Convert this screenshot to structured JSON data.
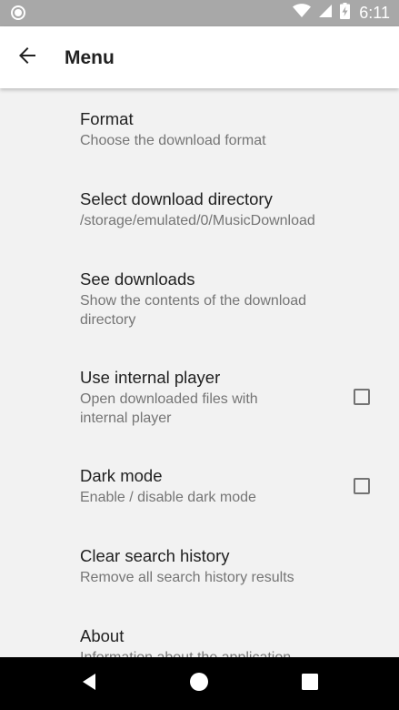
{
  "status_bar": {
    "time": "6:11",
    "left_icon": "circle-notification-icon",
    "right_icons": [
      "wifi-icon",
      "signal-icon",
      "battery-charging-icon"
    ]
  },
  "app_bar": {
    "title": "Menu",
    "back_icon": "arrow-back-icon"
  },
  "menu": {
    "items": [
      {
        "title": "Format",
        "subtitle": "Choose the download format"
      },
      {
        "title": "Select download directory",
        "subtitle": "/storage/emulated/0/MusicDownload"
      },
      {
        "title": "See downloads",
        "subtitle": "Show the contents of the download directory"
      },
      {
        "title": "Use internal player",
        "subtitle": "Open downloaded files with internal player",
        "checked": false
      },
      {
        "title": "Dark mode",
        "subtitle": "Enable / disable dark mode",
        "checked": false
      },
      {
        "title": "Clear search history",
        "subtitle": "Remove all search history results"
      },
      {
        "title": "About",
        "subtitle": "Information about the application"
      }
    ]
  },
  "nav_bar": {
    "icons": [
      "back-triangle-icon",
      "home-circle-icon",
      "recents-square-icon"
    ]
  },
  "colors": {
    "status_bar": "#a8a8a8",
    "app_bar": "#ffffff",
    "background": "#f2f2f2",
    "primary_text": "#212121",
    "secondary_text": "#757575",
    "nav_bar": "#000000"
  }
}
